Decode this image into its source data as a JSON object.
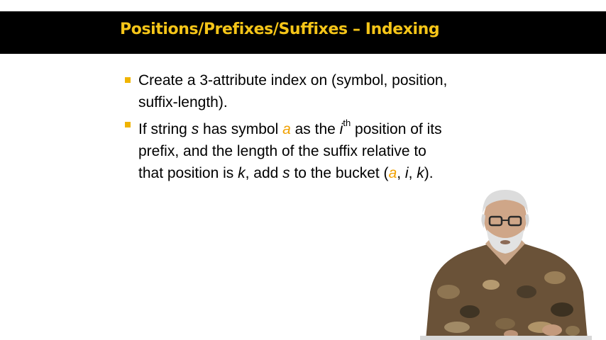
{
  "slide": {
    "title": "Positions/Prefixes/Suffixes – Indexing",
    "colors": {
      "title_bar_bg": "#000000",
      "title_text": "#f5c518",
      "bullet_marker": "#f0b400",
      "highlight": "#f0a000"
    }
  },
  "bullets": [
    {
      "lines": [
        {
          "text": "Create a 3-attribute index on (symbol, position,"
        },
        {
          "text": "suffix-length)."
        }
      ]
    },
    {
      "line1": {
        "t1": "If string ",
        "s1": "s",
        "t2": " has symbol ",
        "a1": "a",
        "t3": " as the ",
        "i1": "i",
        "sup": "th",
        "t4": " position of its"
      },
      "line2": {
        "text": "prefix, and the length of the suffix relative to"
      },
      "line3": {
        "t1": "that position is ",
        "k1": "k",
        "t2": ", add ",
        "s2": "s",
        "t3": " to the bucket (",
        "a2": "a",
        "t4": ", ",
        "i2": "i",
        "t5": ", ",
        "k2": "k",
        "t6": ")."
      }
    }
  ],
  "presenter": {
    "icon": "presenter-video-icon"
  }
}
